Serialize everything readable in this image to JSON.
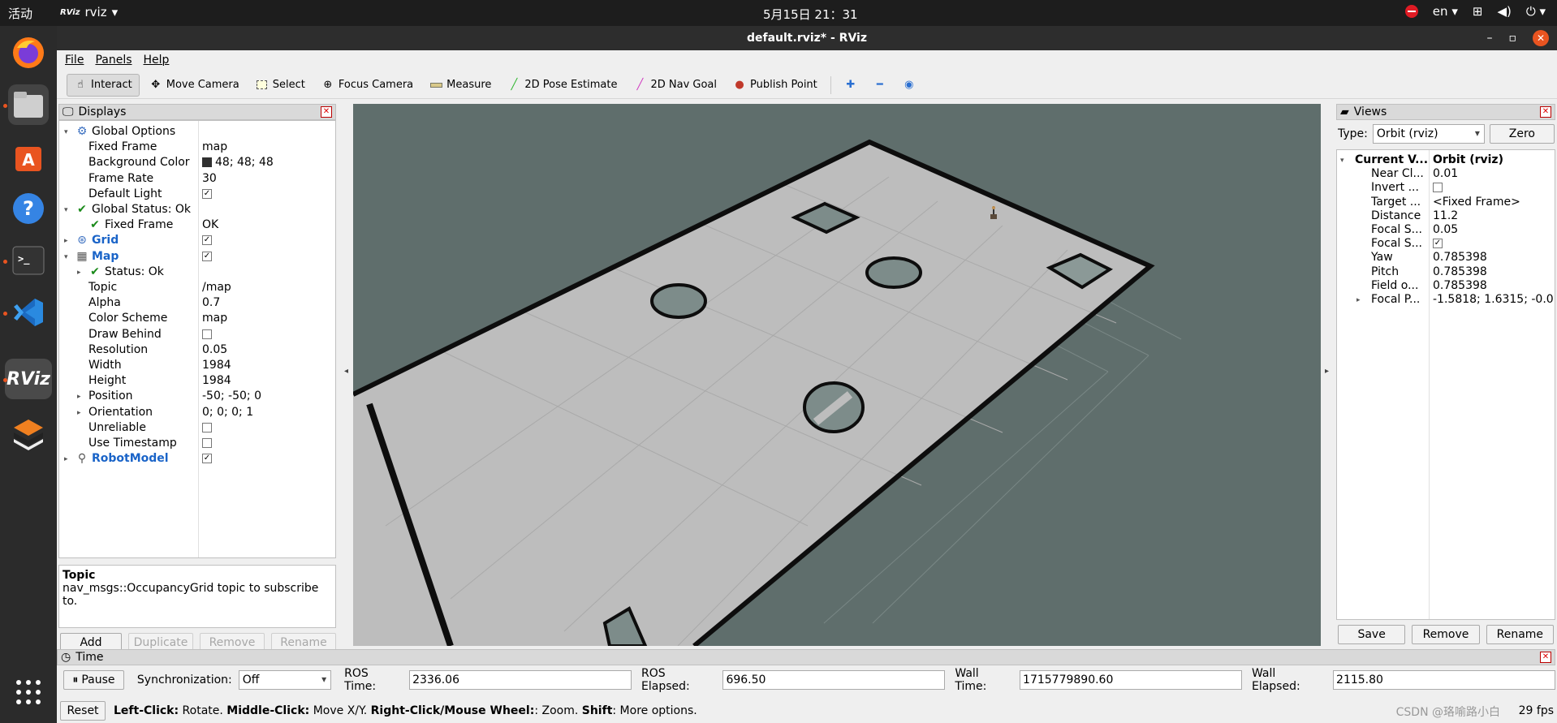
{
  "topbar": {
    "activities": "活动",
    "app_name": "rviz",
    "app_logo_text": "RViz",
    "clock": "5月15日 21：31",
    "lang": "en"
  },
  "dock": {
    "apps": [
      "firefox",
      "files",
      "software",
      "help",
      "terminal",
      "vscode",
      "rviz",
      "blocks"
    ],
    "rviz_label": "RViz"
  },
  "window": {
    "title": "default.rviz* - RViz"
  },
  "menu": [
    "File",
    "Panels",
    "Help"
  ],
  "toolbar": {
    "tools": [
      {
        "label": "Interact",
        "icon": "hand-icon",
        "active": true
      },
      {
        "label": "Move Camera",
        "icon": "move-icon",
        "active": false
      },
      {
        "label": "Select",
        "icon": "select-icon",
        "active": false
      },
      {
        "label": "Focus Camera",
        "icon": "focus-icon",
        "active": false
      },
      {
        "label": "Measure",
        "icon": "ruler-icon",
        "active": false
      },
      {
        "label": "2D Pose Estimate",
        "icon": "green-arrow-icon",
        "active": false
      },
      {
        "label": "2D Nav Goal",
        "icon": "pink-arrow-icon",
        "active": false
      },
      {
        "label": "Publish Point",
        "icon": "pin-icon",
        "active": false
      }
    ]
  },
  "displays": {
    "title": "Displays",
    "rows": [
      {
        "name": "Global Options",
        "value": "",
        "indent": 1,
        "expand": "open",
        "icon": "gear"
      },
      {
        "name": "Fixed Frame",
        "value": "map",
        "indent": 2
      },
      {
        "name": "Background Color",
        "value": "48; 48; 48",
        "indent": 2,
        "swatch": true
      },
      {
        "name": "Frame Rate",
        "value": "30",
        "indent": 2
      },
      {
        "name": "Default Light",
        "value": "",
        "indent": 2,
        "check": true
      },
      {
        "name": "Global Status: Ok",
        "value": "",
        "indent": 1,
        "expand": "open",
        "icon": "ok"
      },
      {
        "name": "Fixed Frame",
        "value": "OK",
        "indent": 2,
        "icon": "ok"
      },
      {
        "name": "Grid",
        "value": "",
        "indent": 1,
        "expand": "closed",
        "icon": "grid",
        "blue": true,
        "check": true
      },
      {
        "name": "Map",
        "value": "",
        "indent": 1,
        "expand": "open",
        "icon": "map",
        "blue": true,
        "check": true
      },
      {
        "name": "Status: Ok",
        "value": "",
        "indent": 2,
        "expand": "closed",
        "icon": "ok"
      },
      {
        "name": "Topic",
        "value": "/map",
        "indent": 2
      },
      {
        "name": "Alpha",
        "value": "0.7",
        "indent": 2
      },
      {
        "name": "Color Scheme",
        "value": "map",
        "indent": 2
      },
      {
        "name": "Draw Behind",
        "value": "",
        "indent": 2,
        "check": false
      },
      {
        "name": "Resolution",
        "value": "0.05",
        "indent": 2
      },
      {
        "name": "Width",
        "value": "1984",
        "indent": 2
      },
      {
        "name": "Height",
        "value": "1984",
        "indent": 2
      },
      {
        "name": "Position",
        "value": "-50; -50; 0",
        "indent": 2,
        "expand": "closed"
      },
      {
        "name": "Orientation",
        "value": "0; 0; 0; 1",
        "indent": 2,
        "expand": "closed"
      },
      {
        "name": "Unreliable",
        "value": "",
        "indent": 2,
        "check": false
      },
      {
        "name": "Use Timestamp",
        "value": "",
        "indent": 2,
        "check": false
      },
      {
        "name": "RobotModel",
        "value": "",
        "indent": 1,
        "expand": "closed",
        "icon": "robot",
        "blue": true,
        "check": true
      }
    ],
    "help_title": "Topic",
    "help_text": "nav_msgs::OccupancyGrid topic to subscribe to.",
    "buttons": {
      "add": "Add",
      "duplicate": "Duplicate",
      "remove": "Remove",
      "rename": "Rename"
    }
  },
  "views": {
    "title": "Views",
    "type_label": "Type:",
    "type_value": "Orbit (rviz)",
    "zero_label": "Zero",
    "rows": [
      {
        "name": "Current V...",
        "value": "Orbit (rviz)",
        "bold": true,
        "expand": "open"
      },
      {
        "name": "Near Cl...",
        "value": "0.01"
      },
      {
        "name": "Invert ...",
        "value": "",
        "check": false
      },
      {
        "name": "Target ...",
        "value": "<Fixed Frame>"
      },
      {
        "name": "Distance",
        "value": "11.2"
      },
      {
        "name": "Focal S...",
        "value": "0.05"
      },
      {
        "name": "Focal S...",
        "value": "",
        "check": true
      },
      {
        "name": "Yaw",
        "value": "0.785398"
      },
      {
        "name": "Pitch",
        "value": "0.785398"
      },
      {
        "name": "Field o...",
        "value": "0.785398"
      },
      {
        "name": "Focal P...",
        "value": "-1.5818; 1.6315; -0.0...",
        "expand": "closed"
      }
    ],
    "buttons": {
      "save": "Save",
      "remove": "Remove",
      "rename": "Rename"
    }
  },
  "time": {
    "title": "Time",
    "pause_label": "Pause",
    "sync_label": "Synchronization:",
    "sync_value": "Off",
    "ros_time_label": "ROS Time:",
    "ros_time": "2336.06",
    "ros_elapsed_label": "ROS Elapsed:",
    "ros_elapsed": "696.50",
    "wall_time_label": "Wall Time:",
    "wall_time": "1715779890.60",
    "wall_elapsed_label": "Wall Elapsed:",
    "wall_elapsed": "2115.80"
  },
  "status": {
    "reset_label": "Reset",
    "k1": "Left-Click:",
    "v1": " Rotate. ",
    "k2": "Middle-Click:",
    "v2": " Move X/Y. ",
    "k3": "Right-Click/Mouse Wheel:",
    "v3": ": Zoom. ",
    "k4": "Shift",
    "v4": ": More options.",
    "fps": "29 fps",
    "watermark": "CSDN @珞喻路小白"
  },
  "colors": {
    "viewport_bg": "#5f6e6c",
    "map_free": "#bdbdbd",
    "map_wall": "#0d0d0d",
    "accent_blue": "#1a64c8",
    "ok_green": "#1a8a1a"
  }
}
